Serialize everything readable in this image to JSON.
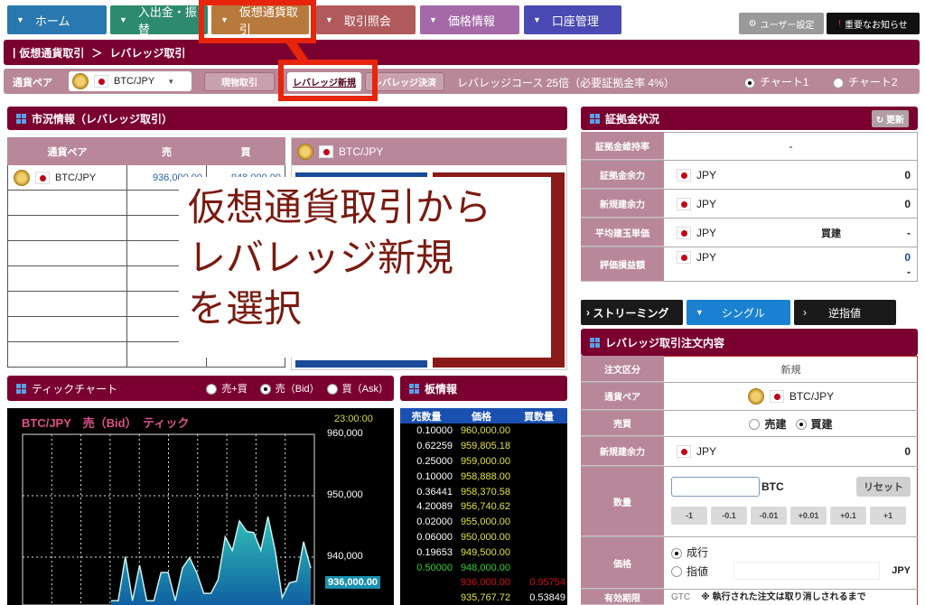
{
  "nav": {
    "items": [
      {
        "label": "ホーム",
        "color": "#2a78b0"
      },
      {
        "label": "入出金・振替",
        "color": "#2e8a6e"
      },
      {
        "label": "仮想通貨取引",
        "color": "#b87a3c"
      },
      {
        "label": "取引照会",
        "color": "#b05a5c"
      },
      {
        "label": "価格情報",
        "color": "#a46aa8"
      },
      {
        "label": "口座管理",
        "color": "#4a4ab2"
      }
    ],
    "user_settings": "ユーザー設定",
    "notice": "重要なお知らせ"
  },
  "breadcrumb": {
    "parent": "仮想通貨取引",
    "separator": "＞",
    "current": "レバレッジ取引"
  },
  "pair_bar": {
    "label": "通貨ペア",
    "selected_pair": "BTC/JPY",
    "buttons": [
      "現物取引",
      "レバレッジ新規",
      "レバレッジ決済"
    ],
    "course": "レバレッジコース 25倍（必要証拠金率 4%）",
    "chart_options": [
      "チャート1",
      "チャート2"
    ],
    "chart_selected": "チャート1"
  },
  "market": {
    "title": "市況情報（レバレッジ取引）",
    "columns": [
      "通貨ペア",
      "売",
      "買"
    ],
    "rows": [
      {
        "pair": "BTC/JPY",
        "sell": "936,000.00",
        "buy": "948,000.00"
      }
    ],
    "card_pair": "BTC/JPY"
  },
  "overlay": {
    "lines": [
      "仮想通貨取引から",
      "レバレッジ新規",
      "を選択"
    ],
    "color": "#7a1a10"
  },
  "tick_chart": {
    "title": "ティックチャート",
    "options": [
      "売+買",
      "売（Bid）",
      "買（Ask）"
    ],
    "selected": "売（Bid）"
  },
  "chart_data": {
    "type": "area",
    "title": "BTC/JPY　売（Bid）　ティック",
    "time": "23:00:00",
    "y_ticks": [
      "960,000",
      "950,000",
      "940,000"
    ],
    "ylim": [
      930000,
      960000
    ],
    "grid": true,
    "current_label": "936,000.00",
    "values": [
      932900,
      932900,
      940100,
      932900,
      938700,
      932900,
      932900,
      937500,
      937500,
      932900,
      938200,
      939900,
      937500,
      934100,
      934100,
      936300,
      943300,
      941100,
      945900,
      944200,
      944000,
      941100,
      946600,
      941100,
      933400,
      935800,
      936100,
      942500,
      938200
    ]
  },
  "order_book": {
    "title": "板情報",
    "columns": [
      "売数量",
      "価格",
      "買数量"
    ],
    "rows": [
      {
        "ask_qty": "0.10000",
        "price": "960,000.00",
        "bid_qty": ""
      },
      {
        "ask_qty": "0.62259",
        "price": "959,805.18",
        "bid_qty": ""
      },
      {
        "ask_qty": "0.25000",
        "price": "959,000.00",
        "bid_qty": ""
      },
      {
        "ask_qty": "0.10000",
        "price": "958,888.00",
        "bid_qty": ""
      },
      {
        "ask_qty": "0.36441",
        "price": "958,370.58",
        "bid_qty": ""
      },
      {
        "ask_qty": "4.20089",
        "price": "956,740.62",
        "bid_qty": ""
      },
      {
        "ask_qty": "0.02000",
        "price": "955,000.00",
        "bid_qty": ""
      },
      {
        "ask_qty": "0.06000",
        "price": "950,000.00",
        "bid_qty": ""
      },
      {
        "ask_qty": "0.19653",
        "price": "949,500.00",
        "bid_qty": ""
      },
      {
        "ask_qty": "0.50000",
        "price": "948,000.00",
        "bid_qty": "",
        "kind": "best-ask"
      },
      {
        "ask_qty": "",
        "price": "936,000.00",
        "bid_qty": "0.95754",
        "kind": "best-bid"
      },
      {
        "ask_qty": "",
        "price": "935,767.72",
        "bid_qty": "0.53849"
      }
    ]
  },
  "margin": {
    "title": "証拠金状況",
    "refresh": "更新",
    "rows": [
      {
        "label": "証拠金維持率",
        "value": "-"
      },
      {
        "label": "証拠金余力",
        "currency": "JPY",
        "value": "0"
      },
      {
        "label": "新規建余力",
        "currency": "JPY",
        "value": "0"
      },
      {
        "label": "平均建玉単価",
        "currency": "JPY",
        "side": "買建",
        "value": "-"
      },
      {
        "label": "評価損益額",
        "currency": "JPY",
        "value": "0",
        "sub": "-"
      }
    ]
  },
  "order_tabs": [
    "ストリーミング",
    "シングル",
    "逆指値"
  ],
  "order": {
    "title": "レバレッジ取引注文内容",
    "type_label": "注文区分",
    "type_value": "新規",
    "pair_label": "通貨ペア",
    "pair_value": "BTC/JPY",
    "side_label": "売買",
    "sides": [
      "売建",
      "買建"
    ],
    "side_selected": "買建",
    "power_label": "新規建余力",
    "power_currency": "JPY",
    "power_value": "0",
    "qty_label": "数量",
    "qty_value": "",
    "qty_unit": "BTC",
    "reset": "リセット",
    "steps": [
      "-1",
      "-0.1",
      "-0.01",
      "+0.01",
      "+0.1",
      "+1"
    ],
    "price_label": "価格",
    "price_types": [
      "成行",
      "指値"
    ],
    "price_selected": "成行",
    "price_value": "",
    "price_unit": "JPY",
    "expiry_label": "有効期限",
    "expiry_value": "GTC",
    "expiry_note": "※ 執行された注文は取り消しされるまで"
  }
}
